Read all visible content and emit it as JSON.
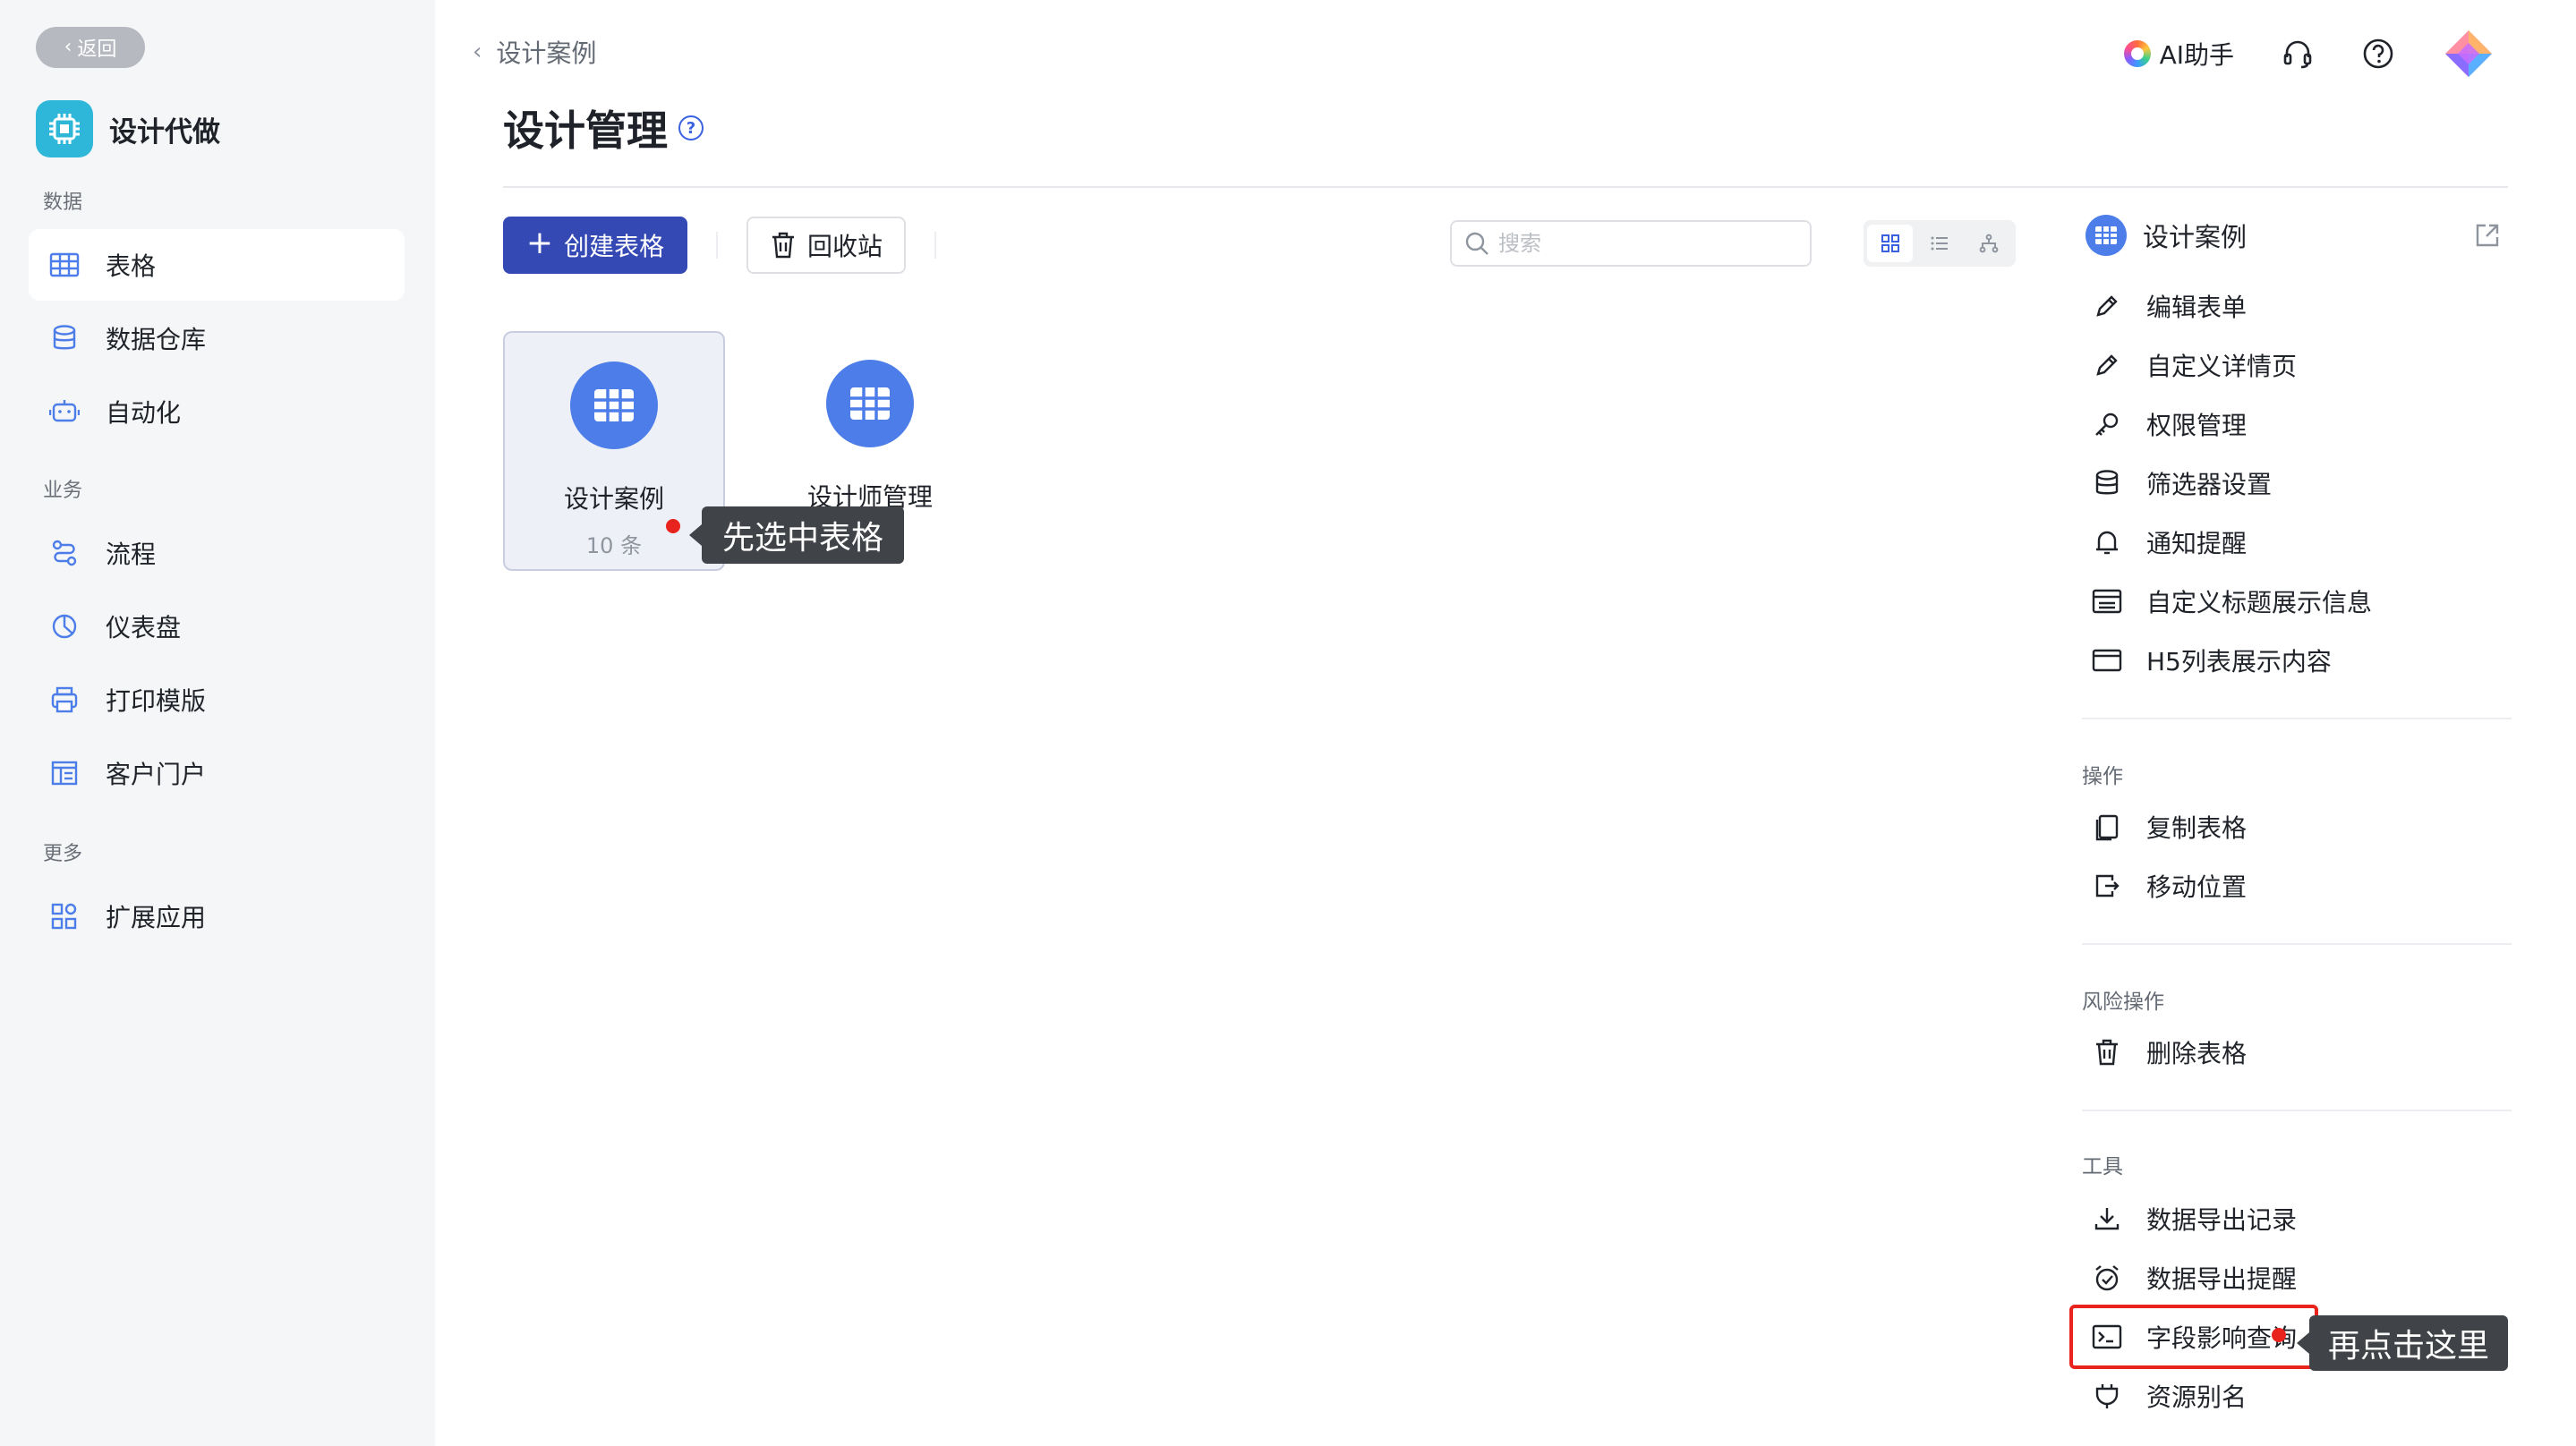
{
  "sidebar": {
    "back_label": "返回",
    "app_name": "设计代做",
    "groups": [
      {
        "label": "数据",
        "items": [
          {
            "label": "表格",
            "icon": "table-icon"
          },
          {
            "label": "数据仓库",
            "icon": "database-icon"
          },
          {
            "label": "自动化",
            "icon": "robot-icon"
          }
        ]
      },
      {
        "label": "业务",
        "items": [
          {
            "label": "流程",
            "icon": "flow-icon"
          },
          {
            "label": "仪表盘",
            "icon": "dashboard-icon"
          },
          {
            "label": "打印模版",
            "icon": "printer-icon"
          },
          {
            "label": "客户门户",
            "icon": "portal-icon"
          }
        ]
      },
      {
        "label": "更多",
        "items": [
          {
            "label": "扩展应用",
            "icon": "apps-icon"
          }
        ]
      }
    ]
  },
  "header": {
    "breadcrumb": "设计案例",
    "title": "设计管理",
    "ai_label": "AI助手"
  },
  "toolbar": {
    "create_label": "创建表格",
    "recycle_label": "回收站",
    "search_placeholder": "搜索"
  },
  "cards": [
    {
      "name": "设计案例",
      "count": "10 条",
      "selected": true
    },
    {
      "name": "设计师管理",
      "count": "",
      "selected": false
    }
  ],
  "tooltips": {
    "first": "先选中表格",
    "second": "再点击这里"
  },
  "panel": {
    "title": "设计案例",
    "items": [
      {
        "label": "编辑表单",
        "icon": "pencil-icon"
      },
      {
        "label": "自定义详情页",
        "icon": "pencil-icon"
      },
      {
        "label": "权限管理",
        "icon": "key-icon"
      },
      {
        "label": "筛选器设置",
        "icon": "database-icon"
      },
      {
        "label": "通知提醒",
        "icon": "bell-icon"
      },
      {
        "label": "自定义标题展示信息",
        "icon": "title-card-icon"
      },
      {
        "label": "H5列表展示内容",
        "icon": "window-icon"
      }
    ],
    "ops_label": "操作",
    "ops": [
      {
        "label": "复制表格",
        "icon": "copy-icon"
      },
      {
        "label": "移动位置",
        "icon": "move-icon"
      }
    ],
    "risk_label": "风险操作",
    "risk": [
      {
        "label": "删除表格",
        "icon": "trash-icon"
      }
    ],
    "tools_label": "工具",
    "tools": [
      {
        "label": "数据导出记录",
        "icon": "download-icon"
      },
      {
        "label": "数据导出提醒",
        "icon": "alarm-icon"
      },
      {
        "label": "字段影响查询",
        "icon": "terminal-icon"
      },
      {
        "label": "资源别名",
        "icon": "plug-icon"
      }
    ]
  },
  "colors": {
    "primary": "#3449b4",
    "accent_blue": "#4c7de8",
    "highlight_red": "#e8231d",
    "sidebar_bg": "#f5f6f7"
  }
}
